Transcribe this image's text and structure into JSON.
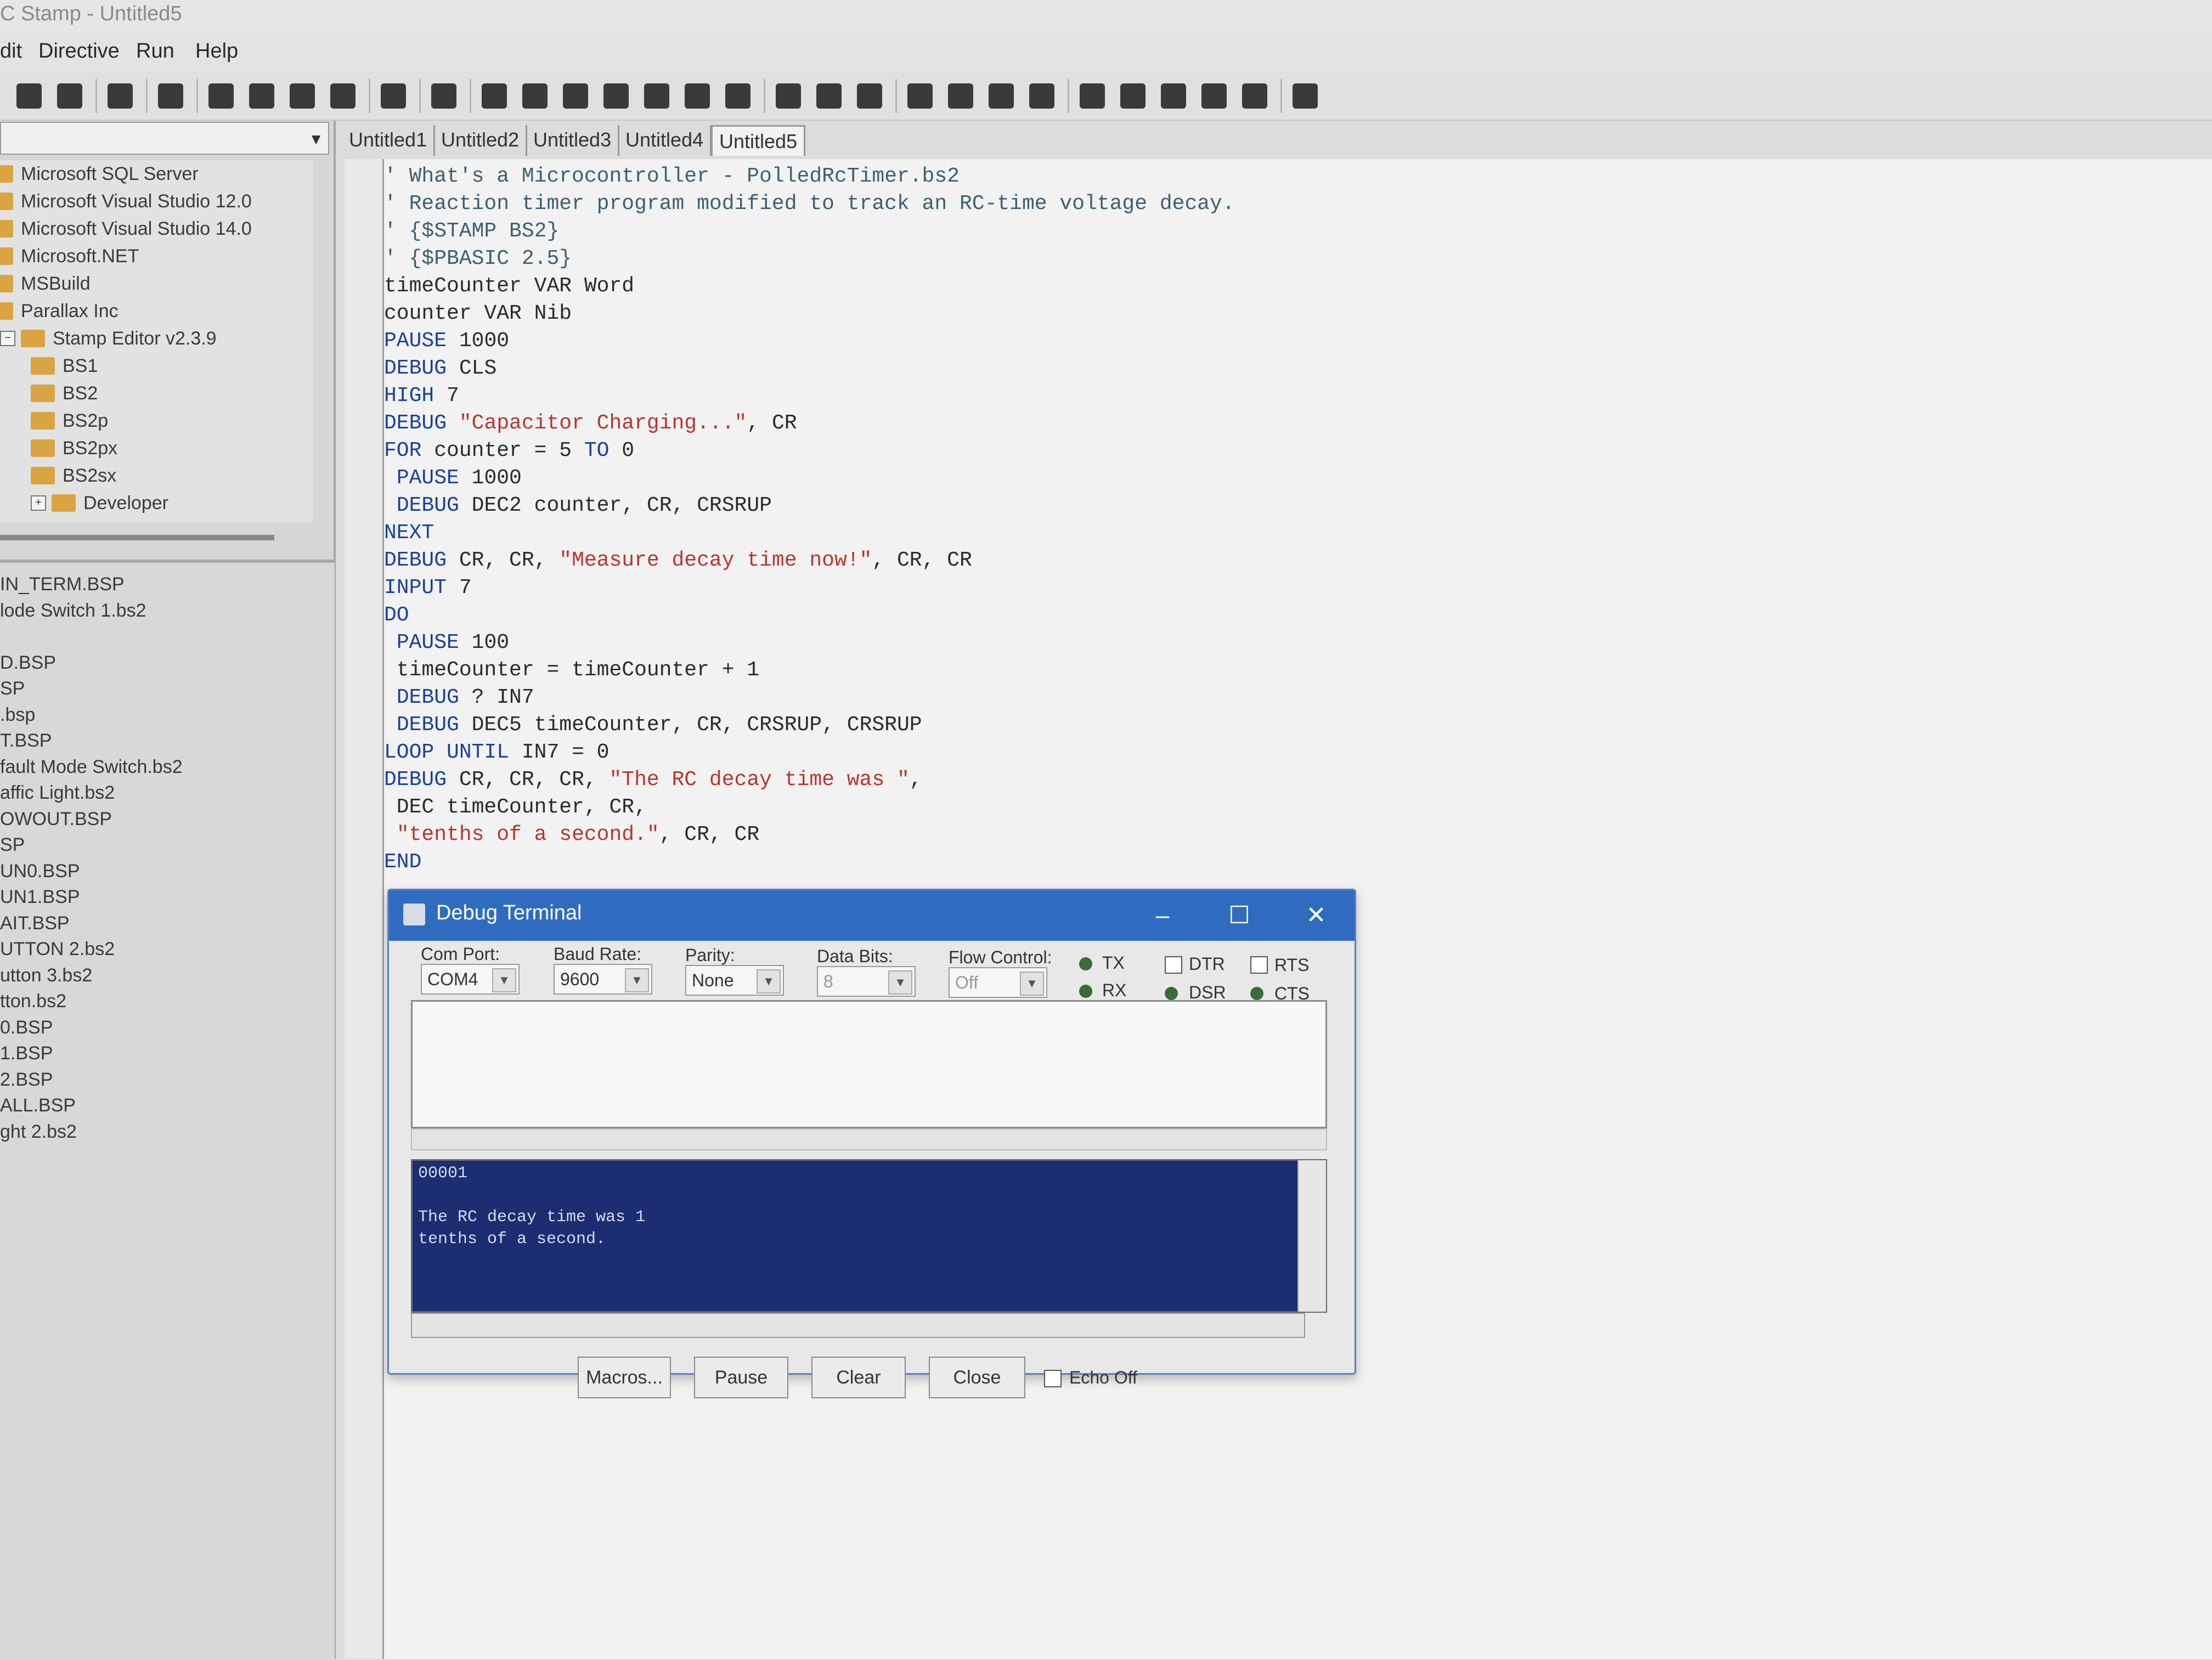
{
  "window": {
    "title": "C Stamp - Untitled5"
  },
  "menu": [
    "dit",
    "Directive",
    "Run",
    "Help"
  ],
  "toolbar": {
    "icons": [
      "open-icon",
      "save-icon",
      "find-file-icon",
      "print-icon",
      "cut-icon",
      "copy-icon",
      "paste-icon",
      "find-icon",
      "directive-icon",
      "properties-icon",
      "memory-map-icon",
      "bs1-icon",
      "bs2-icon",
      "bs2e-icon",
      "bs2sx-icon",
      "bs2p-icon",
      "bs2pe-icon",
      "identify-icon",
      "identify-2-icon",
      "identify-3-icon",
      "memory-icon",
      "check-syntax-icon",
      "run-icon",
      "play-icon",
      "debug-icon",
      "debug-2-icon",
      "debug-3-icon",
      "debug-4-icon",
      "debug-5-icon",
      "help-icon"
    ]
  },
  "left_pane": {
    "tree": [
      {
        "label": "Microsoft SQL Server",
        "indent": 0
      },
      {
        "label": "Microsoft Visual Studio 12.0",
        "indent": 0
      },
      {
        "label": "Microsoft Visual Studio 14.0",
        "indent": 0
      },
      {
        "label": "Microsoft.NET",
        "indent": 0
      },
      {
        "label": "MSBuild",
        "indent": 0
      },
      {
        "label": "Parallax Inc",
        "indent": 0
      },
      {
        "label": "Stamp Editor v2.3.9",
        "indent": 1,
        "expander": "−"
      },
      {
        "label": "BS1",
        "indent": 2
      },
      {
        "label": "BS2",
        "indent": 2
      },
      {
        "label": "BS2p",
        "indent": 2
      },
      {
        "label": "BS2px",
        "indent": 2
      },
      {
        "label": "BS2sx",
        "indent": 2
      },
      {
        "label": "Developer",
        "indent": 2,
        "expander": "+"
      }
    ],
    "files": [
      "IN_TERM.BSP",
      "lode Switch 1.bs2",
      "",
      "D.BSP",
      "SP",
      ".bsp",
      "T.BSP",
      "fault Mode Switch.bs2",
      "affic Light.bs2",
      "OWOUT.BSP",
      "SP",
      "UN0.BSP",
      "UN1.BSP",
      "AIT.BSP",
      "UTTON 2.bs2",
      "utton 3.bs2",
      "tton.bs2",
      "0.BSP",
      "1.BSP",
      "2.BSP",
      "ALL.BSP",
      "ght 2.bs2"
    ]
  },
  "tabs": [
    {
      "label": "Untitled1",
      "active": false
    },
    {
      "label": "Untitled2",
      "active": false
    },
    {
      "label": "Untitled3",
      "active": false
    },
    {
      "label": "Untitled4",
      "active": false
    },
    {
      "label": "Untitled5",
      "active": true
    }
  ],
  "code": [
    [
      [
        "cmt",
        "' What's a Microcontroller - PolledRcTimer.bs2"
      ]
    ],
    [
      [
        "cmt",
        "' Reaction timer program modified to track an RC-time voltage decay."
      ]
    ],
    [
      [
        "cmt",
        "' {$STAMP BS2}"
      ]
    ],
    [
      [
        "cmt",
        "' {$PBASIC 2.5}"
      ]
    ],
    [
      [
        "txt",
        "timeCounter VAR Word"
      ]
    ],
    [
      [
        "txt",
        "counter VAR Nib"
      ]
    ],
    [
      [
        "kw",
        "PAUSE"
      ],
      [
        "txt",
        " 1000"
      ]
    ],
    [
      [
        "kw",
        "DEBUG"
      ],
      [
        "txt",
        " CLS"
      ]
    ],
    [
      [
        "kw",
        "HIGH"
      ],
      [
        "txt",
        " 7"
      ]
    ],
    [
      [
        "kw",
        "DEBUG"
      ],
      [
        "txt",
        " "
      ],
      [
        "str",
        "\"Capacitor Charging...\""
      ],
      [
        "txt",
        ", CR"
      ]
    ],
    [
      [
        "kw",
        "FOR"
      ],
      [
        "txt",
        " counter = 5 "
      ],
      [
        "kw",
        "TO"
      ],
      [
        "txt",
        " 0"
      ]
    ],
    [
      [
        "txt",
        " "
      ],
      [
        "kw",
        "PAUSE"
      ],
      [
        "txt",
        " 1000"
      ]
    ],
    [
      [
        "txt",
        " "
      ],
      [
        "kw",
        "DEBUG"
      ],
      [
        "txt",
        " DEC2 counter, CR, CRSRUP"
      ]
    ],
    [
      [
        "kw",
        "NEXT"
      ]
    ],
    [
      [
        "kw",
        "DEBUG"
      ],
      [
        "txt",
        " CR, CR, "
      ],
      [
        "str",
        "\"Measure decay time now!\""
      ],
      [
        "txt",
        ", CR, CR"
      ]
    ],
    [
      [
        "kw",
        "INPUT"
      ],
      [
        "txt",
        " 7"
      ]
    ],
    [
      [
        "kw",
        "DO"
      ]
    ],
    [
      [
        "txt",
        " "
      ],
      [
        "kw",
        "PAUSE"
      ],
      [
        "txt",
        " 100"
      ]
    ],
    [
      [
        "txt",
        " timeCounter = timeCounter + 1"
      ]
    ],
    [
      [
        "txt",
        " "
      ],
      [
        "kw",
        "DEBUG"
      ],
      [
        "txt",
        " ? IN7"
      ]
    ],
    [
      [
        "txt",
        " "
      ],
      [
        "kw",
        "DEBUG"
      ],
      [
        "txt",
        " DEC5 timeCounter, CR, CRSRUP, CRSRUP"
      ]
    ],
    [
      [
        "kw",
        "LOOP UNTIL"
      ],
      [
        "txt",
        " IN7 = 0"
      ]
    ],
    [
      [
        "kw",
        "DEBUG"
      ],
      [
        "txt",
        " CR, CR, CR, "
      ],
      [
        "str",
        "\"The RC decay time was \""
      ],
      [
        "txt",
        ","
      ]
    ],
    [
      [
        "txt",
        " DEC timeCounter, CR,"
      ]
    ],
    [
      [
        "txt",
        " "
      ],
      [
        "str",
        "\"tenths of a second.\""
      ],
      [
        "txt",
        ", CR, CR"
      ]
    ],
    [
      [
        "kw",
        "END"
      ]
    ]
  ],
  "debug_terminal": {
    "title": "Debug Terminal",
    "com_port": {
      "label": "Com Port:",
      "value": "COM4"
    },
    "baud_rate": {
      "label": "Baud Rate:",
      "value": "9600"
    },
    "parity": {
      "label": "Parity:",
      "value": "None"
    },
    "data_bits": {
      "label": "Data Bits:",
      "value": "8"
    },
    "flow_control": {
      "label": "Flow Control:",
      "value": "Off"
    },
    "indicators": {
      "tx": "TX",
      "rx": "RX",
      "dtr": "DTR",
      "rts": "RTS",
      "dsr": "DSR",
      "cts": "CTS"
    },
    "receive_lines": [
      "00001",
      "",
      "The RC decay time was 1",
      "tenths of a second."
    ],
    "buttons": {
      "macros": "Macros...",
      "pause": "Pause",
      "clear": "Clear",
      "close": "Close"
    },
    "echo_off": "Echo Off",
    "colors": {
      "receive_bg": "#1c2d72",
      "title_bg": "#2f6cc0"
    }
  }
}
